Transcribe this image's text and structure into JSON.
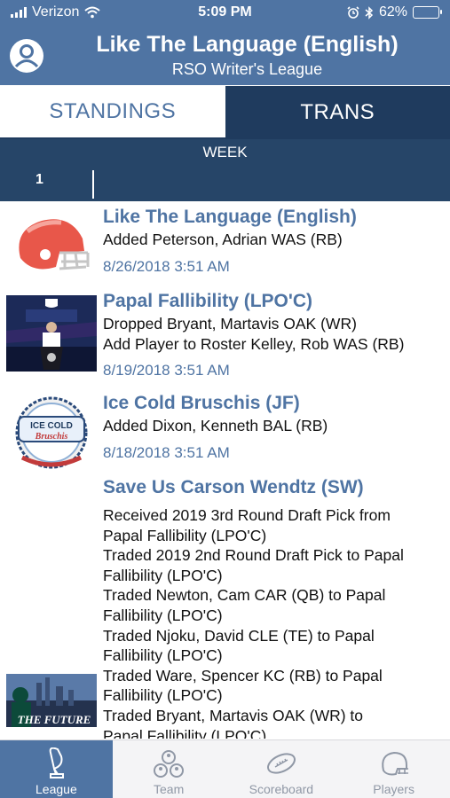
{
  "status_bar": {
    "carrier": "Verizon",
    "time": "5:09 PM",
    "battery": "62%",
    "battery_level": 0.62
  },
  "header": {
    "title": "Like The Language (English)",
    "subtitle": "RSO Writer's League"
  },
  "tabs": [
    {
      "label": "STANDINGS",
      "active": false
    },
    {
      "label": "TRANS",
      "active": true
    }
  ],
  "week": {
    "label": "WEEK",
    "selected": "1"
  },
  "transactions": [
    {
      "team": "Like The Language (English)",
      "image": "football-helmet-icon",
      "lines": [
        "Added Peterson, Adrian WAS  (RB)"
      ],
      "date": "8/26/2018 3:51 AM"
    },
    {
      "team": "Papal Fallibility (LPO'C)",
      "image": "nfl-draft-podium-photo",
      "lines": [
        "Dropped Bryant, Martavis OAK  (WR)",
        "Add Player to Roster Kelley, Rob WAS  (RB)"
      ],
      "date": "8/19/2018 3:51 AM"
    },
    {
      "team": "Ice Cold Bruschis (JF)",
      "image": "ice-cold-bruschis-logo",
      "logo_text": {
        "top": "ICE COLD",
        "script": "Bruschis"
      },
      "lines": [
        "Added Dixon, Kenneth BAL  (RB)"
      ],
      "date": "8/18/2018 3:51 AM"
    },
    {
      "team": "Save Us Carson Wendtz (SW)",
      "image": "the-future-player-photo",
      "logo_text": {
        "banner": "THE FUTURE"
      },
      "lines": [
        "Received 2019 3rd Round Draft Pick from",
        "Papal Fallibility (LPO'C)",
        "Traded 2019 2nd Round Draft Pick to Papal",
        "Fallibility (LPO'C)",
        "Traded Newton, Cam CAR  (QB) to Papal",
        "Fallibility (LPO'C)",
        "Traded Njoku, David CLE  (TE) to Papal",
        "Fallibility (LPO'C)",
        "Traded Ware, Spencer KC   (RB) to Papal",
        "Fallibility (LPO'C)",
        "Traded Bryant, Martavis OAK  (WR) to",
        "Papal Fallibility (LPO'C)"
      ]
    }
  ],
  "bottom_nav": [
    {
      "label": "League",
      "icon": "trophy-icon",
      "active": true
    },
    {
      "label": "Team",
      "icon": "team-icon",
      "active": false
    },
    {
      "label": "Scoreboard",
      "icon": "football-icon",
      "active": false
    },
    {
      "label": "Players",
      "icon": "helmet-icon",
      "active": false
    }
  ],
  "colors": {
    "header_blue": "#4f74a3",
    "dark_navy": "#1f3b5e",
    "week_bar": "#264568",
    "link_blue": "#4f74a3"
  }
}
